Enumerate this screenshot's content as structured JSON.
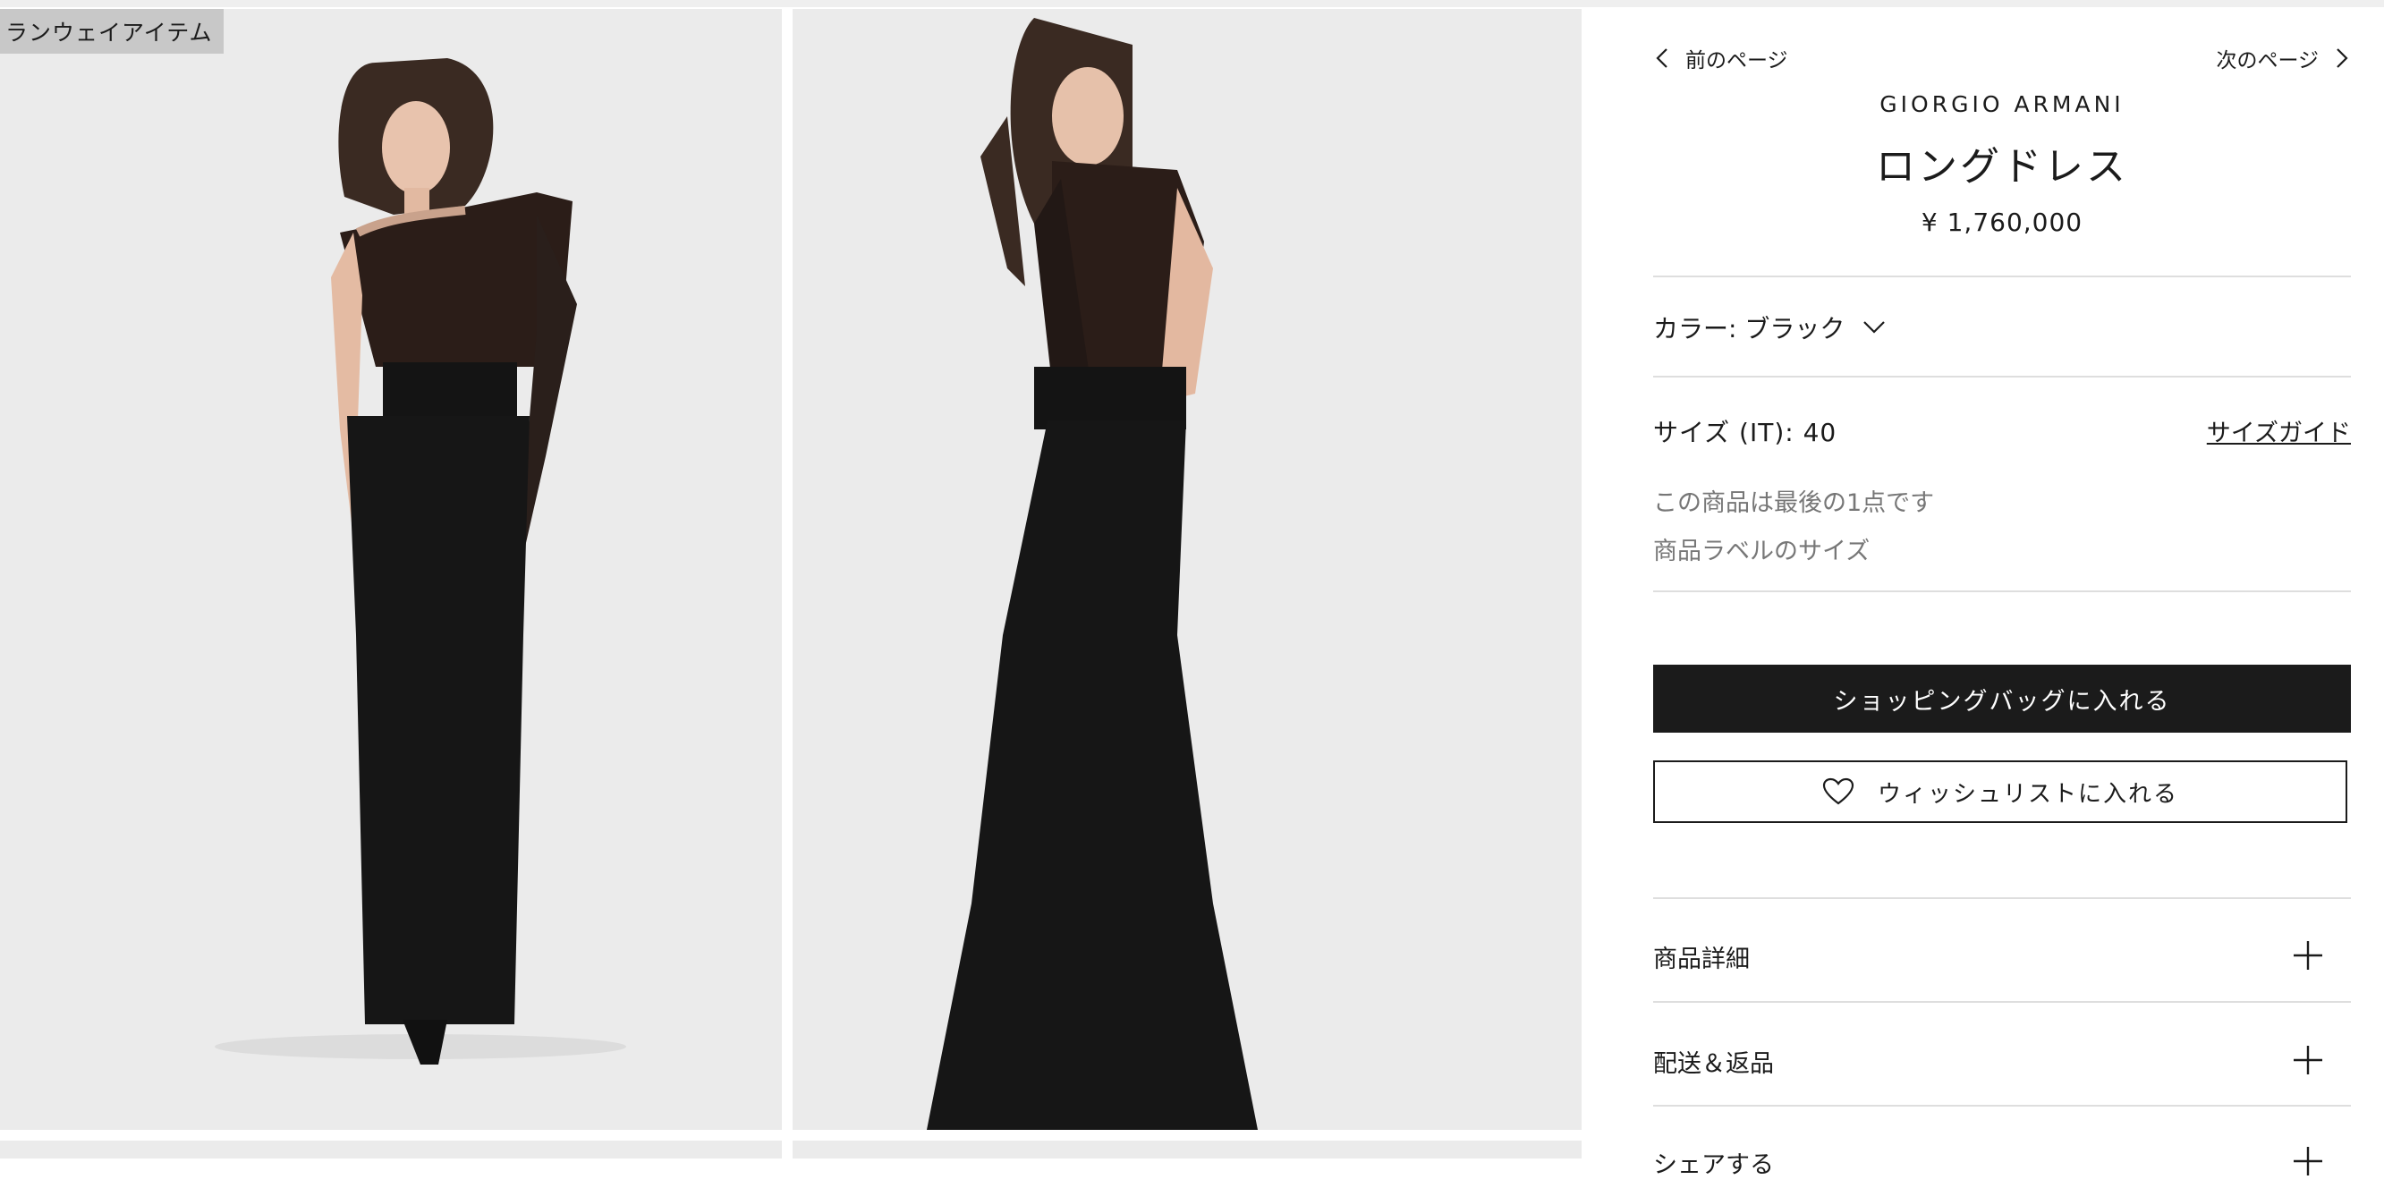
{
  "gallery": {
    "badge": "ランウェイアイテム"
  },
  "nav": {
    "prev_label": "前のページ",
    "next_label": "次のページ"
  },
  "product": {
    "brand": "GIORGIO ARMANI",
    "name": "ロングドレス",
    "price": "¥ 1,760,000"
  },
  "color": {
    "label": "カラー: ブラック"
  },
  "size": {
    "label": "サイズ (IT): 40",
    "guide_label": "サイズガイド",
    "stock_note": "この商品は最後の1点です",
    "label_note": "商品ラベルのサイズ"
  },
  "actions": {
    "add_to_bag": "ショッピングバッグに入れる",
    "add_to_wishlist": "ウィッシュリストに入れる"
  },
  "accordion": [
    {
      "label": "商品詳細"
    },
    {
      "label": "配送＆返品"
    },
    {
      "label": "シェアする"
    }
  ],
  "icons": {
    "prev": "chevron-left-icon",
    "next": "chevron-right-icon",
    "color_dropdown": "chevron-down-icon",
    "wishlist": "heart-icon",
    "expand": "plus-icon"
  },
  "colors": {
    "primary_button_bg": "#1b1b1b",
    "photo_bg": "#ebebeb",
    "muted_text": "#777777",
    "badge_bg": "#c8c8c8"
  }
}
